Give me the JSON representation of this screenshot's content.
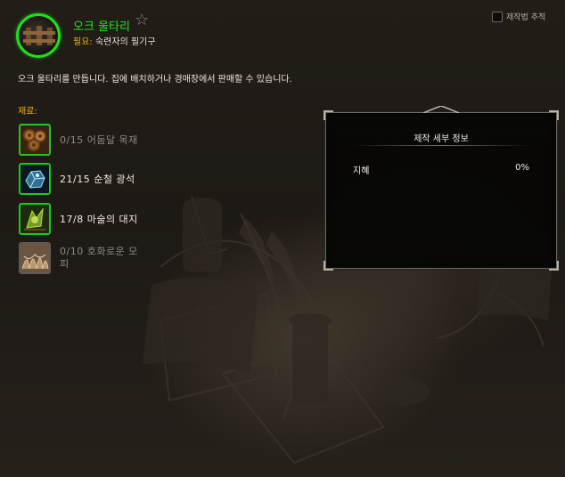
{
  "recipe": {
    "title": "오크 울타리",
    "required_label": "필요:",
    "required_value": "숙련자의 필기구",
    "description": "오크 울타리를 만듭니다. 집에 배치하거나 경매장에서 판매할 수 있습니다.",
    "icon": "fence-icon"
  },
  "track": {
    "label": "제작법 추적",
    "checked": false
  },
  "materials": {
    "header": "재료:",
    "items": [
      {
        "text": "0/15 어둠달 목재",
        "icon": "wood-icon",
        "sufficient": false
      },
      {
        "text": "21/15 순철 광석",
        "icon": "ore-icon",
        "sufficient": true
      },
      {
        "text": "17/8 마술의 대지",
        "icon": "earth-icon",
        "sufficient": true
      },
      {
        "text": "0/10 호화로운 모피",
        "icon": "fur-icon",
        "sufficient": false
      }
    ]
  },
  "details": {
    "title": "제작 세부 정보",
    "stat_name": "지혜",
    "stat_value": "0%"
  },
  "colors": {
    "title_green": "#27e427",
    "label_yellow": "#e2b413",
    "insufficient": "#8d8a84",
    "sufficient": "#f0ece3"
  }
}
